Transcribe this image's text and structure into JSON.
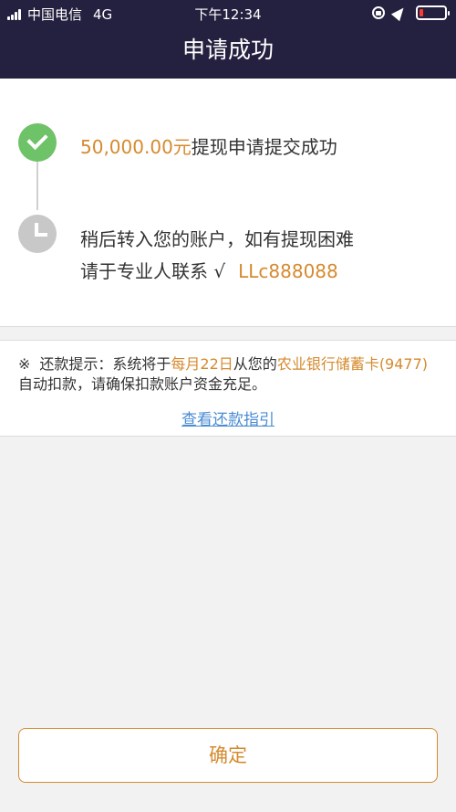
{
  "status_bar": {
    "carrier": "中国电信",
    "network": "4G",
    "time": "下午12:34",
    "battery_level": 0.15
  },
  "nav": {
    "title": "申请成功"
  },
  "steps": {
    "step1_amount": "50,000.00元",
    "step1_text": "提现申请提交成功",
    "step2_line1": "稍后转入您的账户，如有提现困难",
    "step2_line2": "请于专业人联系 √",
    "step2_contact": "LLc888088"
  },
  "notice": {
    "mark": "※",
    "prefix": "还款提示：系统将于",
    "date": "每月22日",
    "middle": "从您的",
    "bank": "农业银行储蓄卡(9477)",
    "suffix": "自动扣款，请确保扣款账户资金充足。",
    "link": "查看还款指引"
  },
  "confirm_button": "确定",
  "colors": {
    "header_bg": "#24203f",
    "accent": "#d58a2e",
    "success": "#6ec268",
    "link": "#4a8bd4"
  }
}
